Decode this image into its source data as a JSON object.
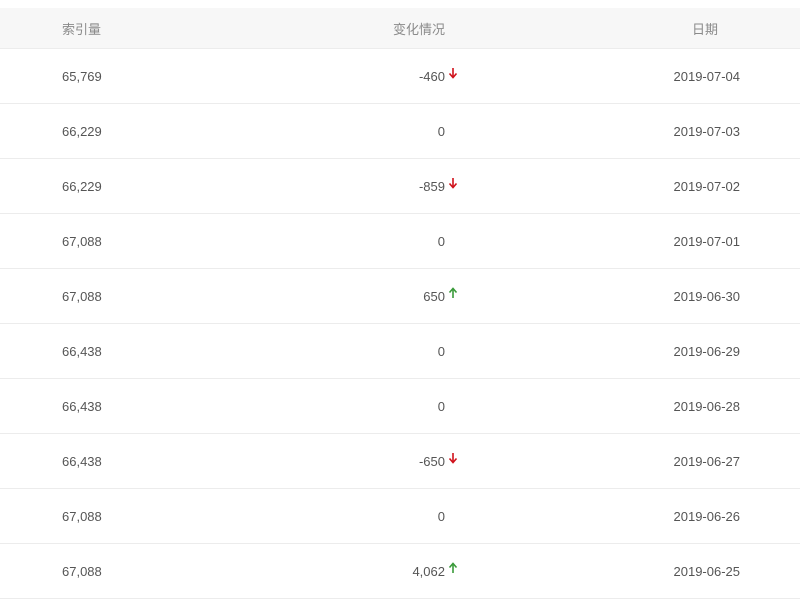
{
  "table": {
    "headers": {
      "index": "索引量",
      "change": "变化情况",
      "date": "日期"
    },
    "rows": [
      {
        "index": "65,769",
        "change": "-460",
        "trend": "down",
        "date": "2019-07-04"
      },
      {
        "index": "66,229",
        "change": "0",
        "trend": "none",
        "date": "2019-07-03"
      },
      {
        "index": "66,229",
        "change": "-859",
        "trend": "down",
        "date": "2019-07-02"
      },
      {
        "index": "67,088",
        "change": "0",
        "trend": "none",
        "date": "2019-07-01"
      },
      {
        "index": "67,088",
        "change": "650",
        "trend": "up",
        "date": "2019-06-30"
      },
      {
        "index": "66,438",
        "change": "0",
        "trend": "none",
        "date": "2019-06-29"
      },
      {
        "index": "66,438",
        "change": "0",
        "trend": "none",
        "date": "2019-06-28"
      },
      {
        "index": "66,438",
        "change": "-650",
        "trend": "down",
        "date": "2019-06-27"
      },
      {
        "index": "67,088",
        "change": "0",
        "trend": "none",
        "date": "2019-06-26"
      },
      {
        "index": "67,088",
        "change": "4,062",
        "trend": "up",
        "date": "2019-06-25"
      }
    ]
  },
  "colors": {
    "down": "#d0111b",
    "up": "#3a9a3a",
    "header_bg": "#f7f7f7",
    "border": "#ececec"
  },
  "icons": {
    "down": "arrow-down-icon",
    "up": "arrow-up-icon"
  }
}
